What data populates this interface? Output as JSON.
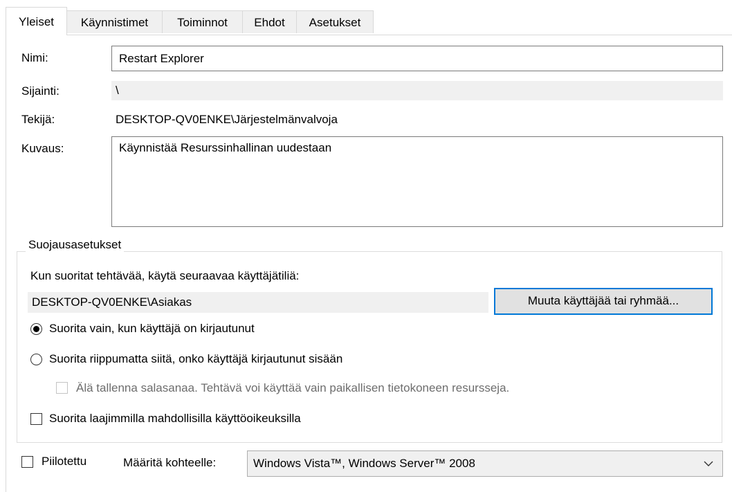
{
  "tabs": [
    {
      "label": "Yleiset",
      "active": true
    },
    {
      "label": "Käynnistimet",
      "active": false
    },
    {
      "label": "Toiminnot",
      "active": false
    },
    {
      "label": "Ehdot",
      "active": false
    },
    {
      "label": "Asetukset",
      "active": false
    }
  ],
  "general": {
    "name_label": "Nimi:",
    "name_value": "Restart Explorer",
    "location_label": "Sijainti:",
    "location_value": "\\",
    "author_label": "Tekijä:",
    "author_value": "DESKTOP-QV0ENKE\\Järjestelmänvalvoja",
    "description_label": "Kuvaus:",
    "description_value": "Käynnistää Resurssinhallinan uudestaan"
  },
  "security": {
    "group_title": "Suojausasetukset",
    "run_as_prompt": "Kun suoritat tehtävää, käytä seuraavaa käyttäjätiliä:",
    "user_account": "DESKTOP-QV0ENKE\\Asiakas",
    "change_user_button": "Muuta käyttäjää tai ryhmää...",
    "radio_logged_on": {
      "label": "Suorita vain, kun käyttäjä on kirjautunut",
      "selected": true
    },
    "radio_whether_logged_on": {
      "label": "Suorita riippumatta siitä, onko käyttäjä kirjautunut sisään",
      "selected": false
    },
    "no_store_password": {
      "label": "Älä tallenna salasanaa. Tehtävä voi käyttää vain paikallisen tietokoneen resursseja.",
      "checked": false,
      "enabled": false
    },
    "highest_privileges": {
      "label": "Suorita laajimmilla mahdollisilla käyttöoikeuksilla",
      "checked": false
    }
  },
  "bottom": {
    "hidden_label": "Piilotettu",
    "hidden_checked": false,
    "configure_for_label": "Määritä kohteelle:",
    "configure_for_value": "Windows Vista™, Windows Server™ 2008"
  }
}
